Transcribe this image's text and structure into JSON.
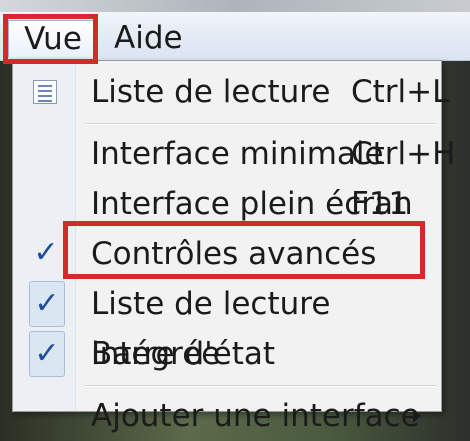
{
  "menubar": {
    "menus": [
      {
        "label": "Vue"
      },
      {
        "label": "Aide"
      }
    ]
  },
  "dropdown": {
    "items": [
      {
        "label": "Liste de lecture",
        "shortcut": "Ctrl+L",
        "icon": "playlist-icon"
      },
      {
        "label": "Interface minimale",
        "shortcut": "Ctrl+H"
      },
      {
        "label": "Interface plein écran",
        "shortcut": "F11"
      },
      {
        "label": "Contrôles avancés",
        "checked": true,
        "check_mark": "✓"
      },
      {
        "label": "Liste de lecture intégrée",
        "checked": true,
        "check_mark": "✓"
      },
      {
        "label": "Barre d'état",
        "checked": true,
        "check_mark": "✓"
      },
      {
        "label": "Ajouter une interface",
        "submenu": true
      }
    ]
  },
  "colors": {
    "highlight": "#d42a2a",
    "check": "#1f4f9c",
    "menu_background": "#f2f2f2"
  }
}
